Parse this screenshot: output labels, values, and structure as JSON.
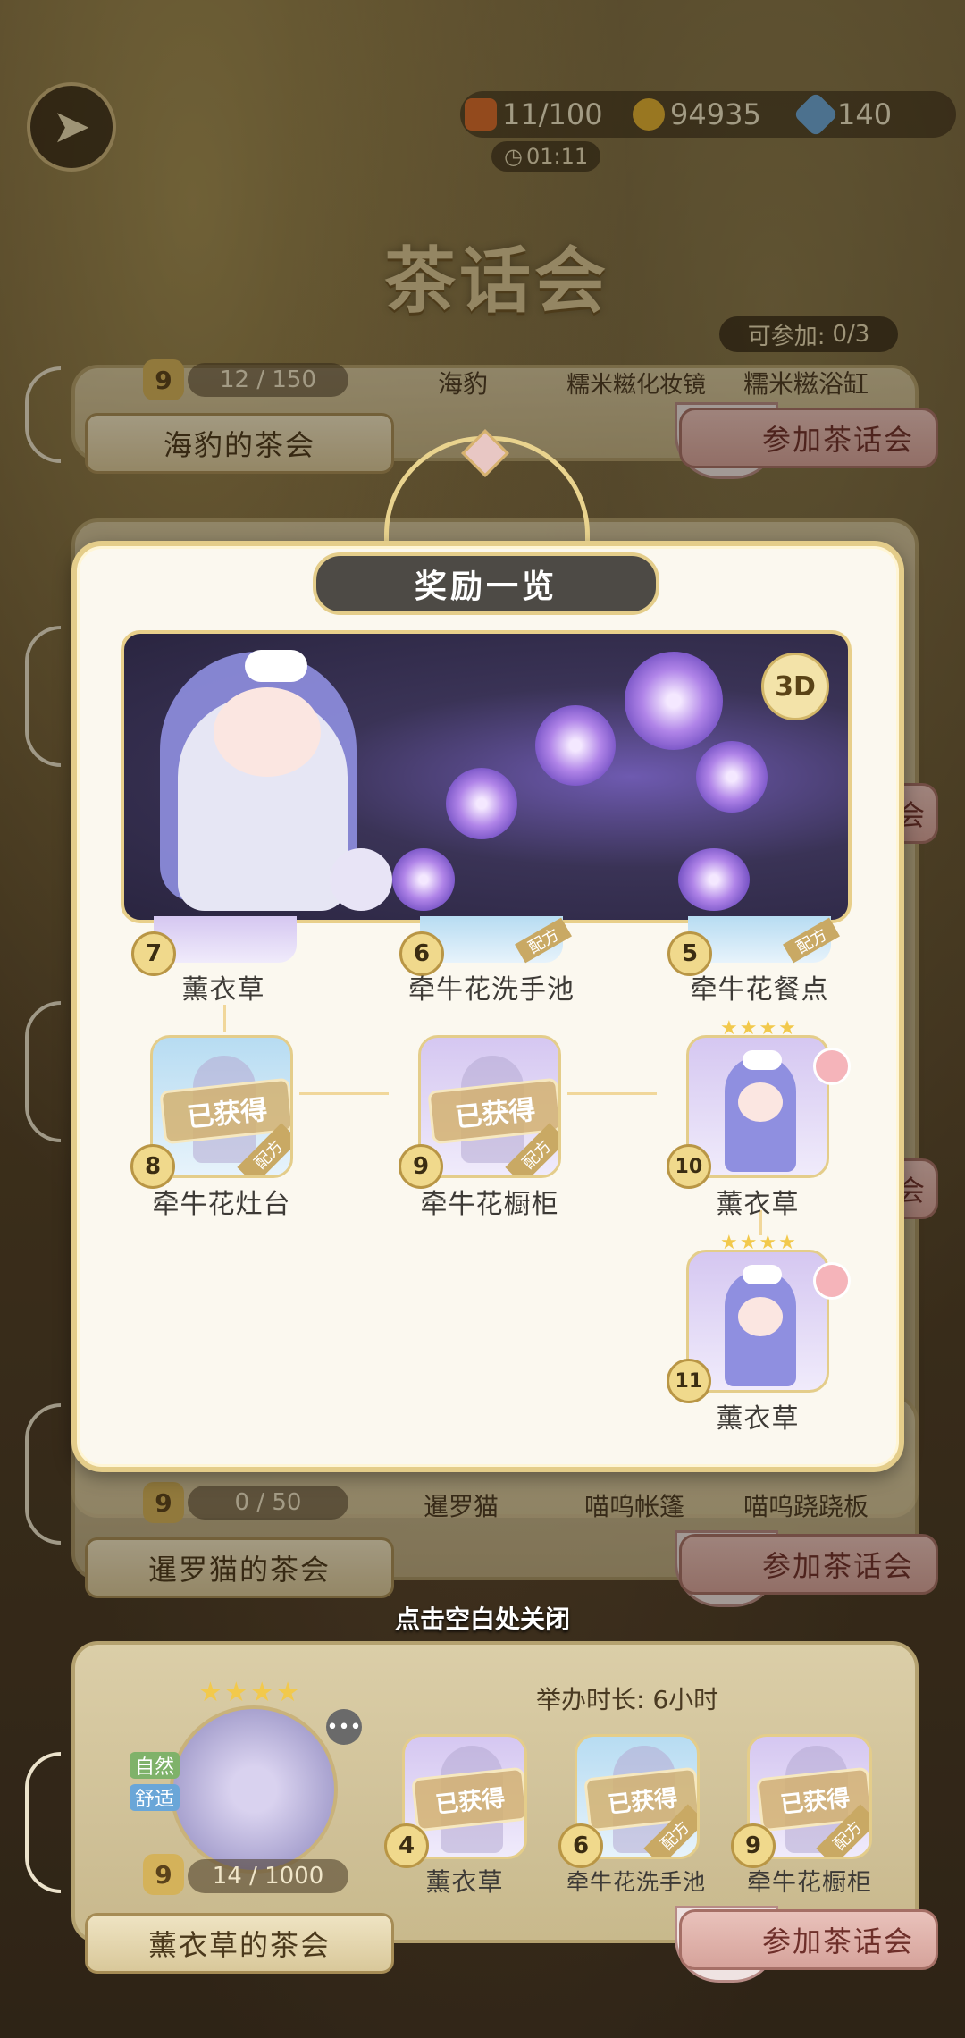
{
  "header": {
    "resources": [
      {
        "name": "energy",
        "value": "11/100",
        "color": "#d86a2a",
        "icon": "jar-icon"
      },
      {
        "name": "coins",
        "value": "94935",
        "color": "#e0b030",
        "icon": "coin-icon"
      },
      {
        "name": "gems",
        "value": "140",
        "color": "#6aa6d8",
        "icon": "gem-icon"
      }
    ],
    "timer": "01:11",
    "title": "茶话会",
    "joinable_label": "可参加:",
    "joinable_value": "0/3"
  },
  "cards": [
    {
      "level": "9",
      "progress": "12 / 150",
      "items": [
        "海豹",
        "糯米糍化妆镜",
        "糯米糍浴缸"
      ],
      "name": "海豹的茶会",
      "join": "参加茶话会"
    },
    {
      "level": "9",
      "progress": "0 / 50",
      "items": [
        "暹罗猫",
        "喵呜帐篷",
        "喵呜跷跷板"
      ],
      "name": "暹罗猫的茶会",
      "join": "参加茶话会"
    },
    {
      "level": "9",
      "progress": "14 / 1000",
      "duration": "举办时长: 6小时",
      "tags": [
        "自然",
        "舒适"
      ],
      "items": [
        {
          "level": "4",
          "label": "薰衣草",
          "status": "已获得"
        },
        {
          "level": "6",
          "label": "牵牛花洗手池",
          "status": "已获得",
          "recipe": "配方"
        },
        {
          "level": "9",
          "label": "牵牛花橱柜",
          "status": "已获得",
          "recipe": "配方"
        }
      ],
      "name": "薰衣草的茶会",
      "join": "参加茶话会"
    }
  ],
  "partial_join_label": "会",
  "close_hint": "点击空白处关闭",
  "modal": {
    "title": "奖励一览",
    "btn_3d": "3D",
    "top_row": [
      {
        "level": "7",
        "label": "薰衣草"
      },
      {
        "level": "6",
        "label": "牵牛花洗手池",
        "recipe": "配方"
      },
      {
        "level": "5",
        "label": "牵牛花餐点",
        "recipe": "配方"
      }
    ],
    "mid_row": [
      {
        "level": "8",
        "label": "牵牛花灶台",
        "status": "已获得",
        "recipe": "配方"
      },
      {
        "level": "9",
        "label": "牵牛花橱柜",
        "status": "已获得",
        "recipe": "配方"
      },
      {
        "level": "10",
        "label": "薰衣草",
        "stars": "★★★★"
      }
    ],
    "last": {
      "level": "11",
      "label": "薰衣草",
      "stars": "★★★★"
    }
  }
}
